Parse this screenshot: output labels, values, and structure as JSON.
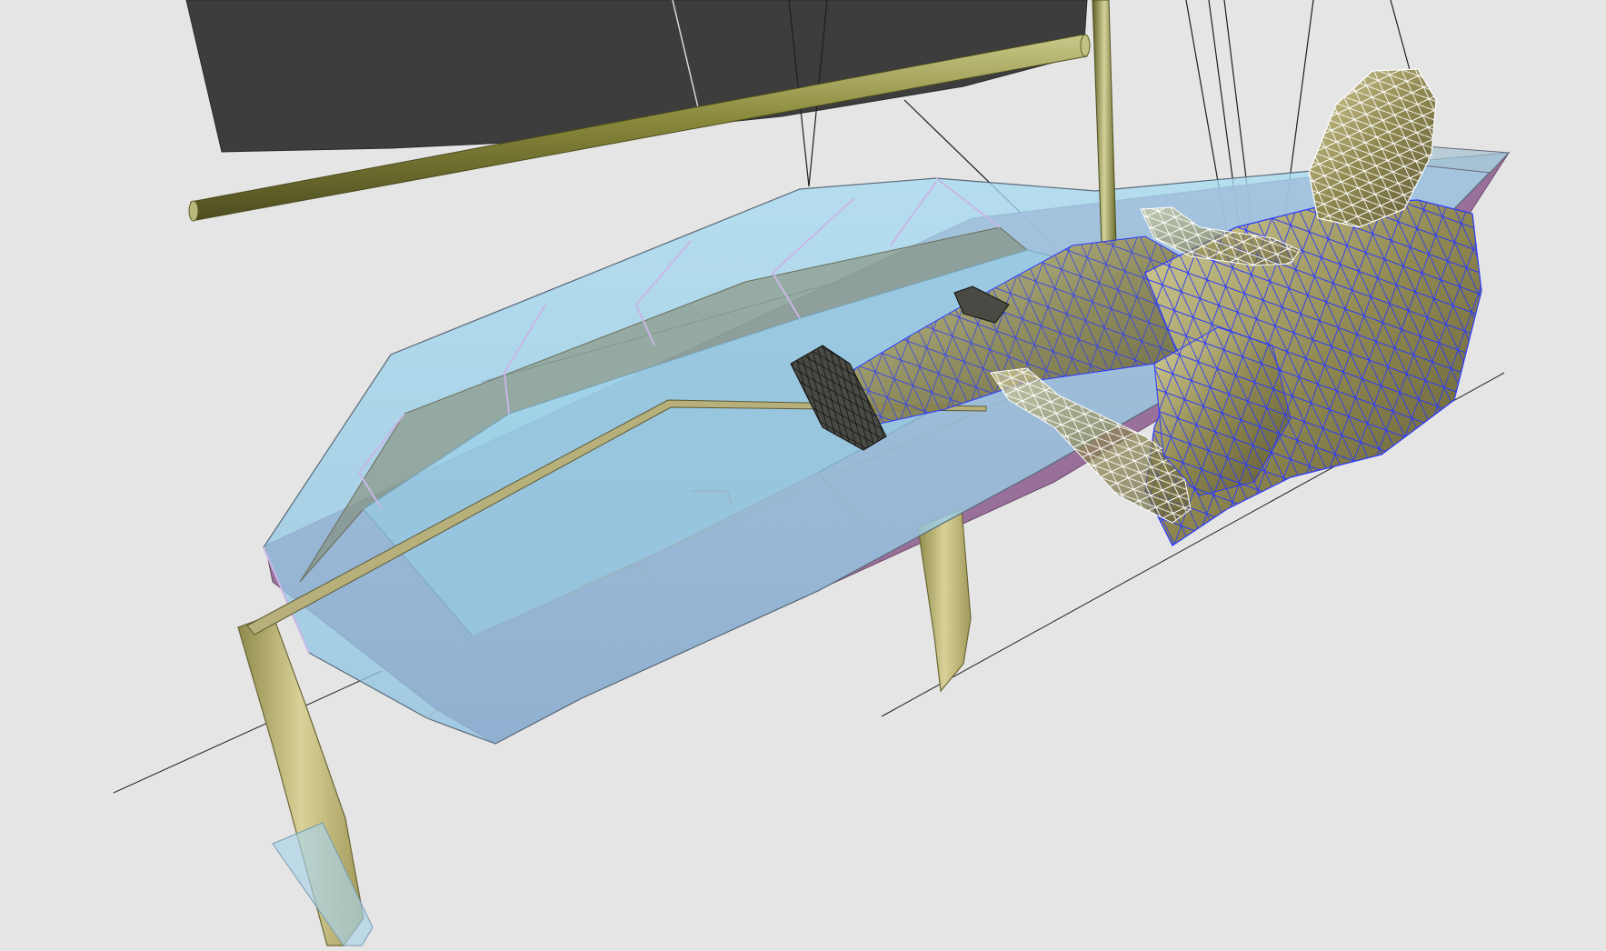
{
  "viewport": {
    "background": "#e5e5e5",
    "render_mode": "shaded-with-wireframe"
  },
  "colors": {
    "sail": "#3d3d3d",
    "spar": "#8a8a3c",
    "hull_glass": "#8fcbe6",
    "hull_bottom": "#8a5a8a",
    "foil": "#c8c07c",
    "sailor_body": "#8f8850",
    "sailor_wire_blue": "#2233ff",
    "sailor_wire_white": "#ffffff",
    "shoes": "#3a3a3a",
    "guide_line": "#222222"
  },
  "scene": {
    "objects": [
      "sail",
      "boom",
      "mast",
      "rigging",
      "hull",
      "tiller",
      "rudder",
      "daggerboard",
      "sailor",
      "waterline-axes"
    ]
  }
}
